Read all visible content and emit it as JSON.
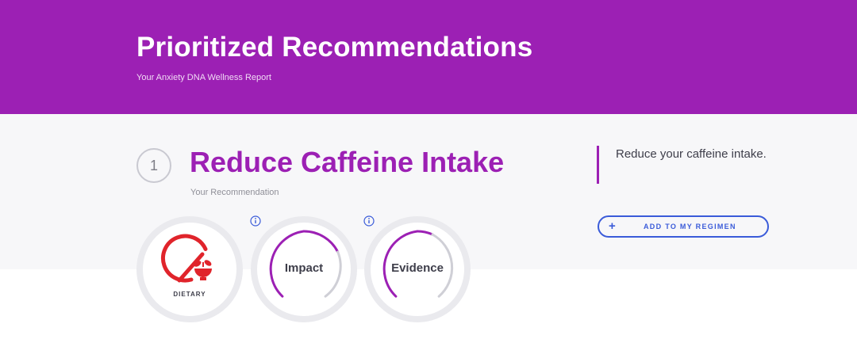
{
  "header": {
    "title": "Prioritized Recommendations",
    "subtitle": "Your Anxiety DNA Wellness Report",
    "background": "#9c20b4"
  },
  "recommendation": {
    "number": "1",
    "title": "Reduce Caffeine Intake",
    "subtitle": "Your Recommendation",
    "summary": "Reduce your caffeine intake.",
    "accent": "#9c20b4"
  },
  "regimen_button": {
    "icon": "plus-icon",
    "label": "ADD TO MY REGIMEN",
    "color": "#3a5bd9"
  },
  "badges": {
    "category": {
      "label": "DIETARY",
      "icon": "no-caffeine-food-icon",
      "color": "#e0242b"
    },
    "impact": {
      "label": "Impact",
      "icon": "info-icon"
    },
    "evidence": {
      "label": "Evidence",
      "icon": "info-icon"
    }
  }
}
